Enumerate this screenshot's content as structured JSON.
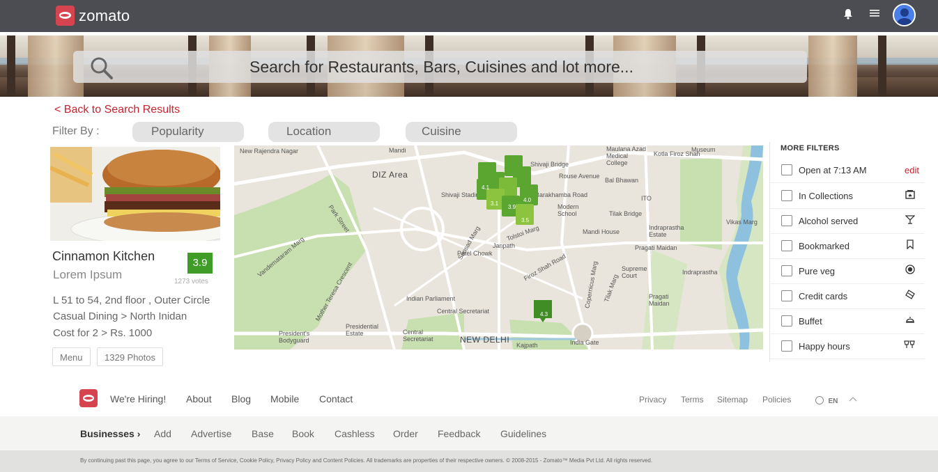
{
  "brand": {
    "name": "zomato"
  },
  "search": {
    "placeholder": "Search for Restaurants, Bars, Cuisines and lot more..."
  },
  "nav": {
    "back": "< Back to Search Results"
  },
  "filter_bar": {
    "label": "Filter By :",
    "options": [
      "Popularity",
      "Location",
      "Cuisine"
    ]
  },
  "restaurant": {
    "name": "Cinnamon Kitchen",
    "subtitle": "Lorem Ipsum",
    "rating": "3.9",
    "votes": "1273 votes",
    "address": "L 51 to 54, 2nd floor , Outer Circle",
    "type": "Casual Dining > North Inidan",
    "cost": "Cost for 2 > Rs. 1000",
    "buttons": [
      "Menu",
      "1329 Photos"
    ]
  },
  "map": {
    "labels": [
      "New Rajendra Nagar",
      "DIZ Area",
      "Mandi",
      "Shivaji Stadium",
      "Shivaji Bridge",
      "Rouse Avenue",
      "Bal Bhawan",
      "Maulana Azad Medical College",
      "Kotla Firoz Shah",
      "Museum",
      "ITO",
      "Vandemataram Marg",
      "Park Street",
      "Sansad Marg",
      "Tolstoi Marg",
      "Janpath",
      "Patel Chowk",
      "Firoz Shah Road",
      "Modern School",
      "Tilak Bridge",
      "Mandi House",
      "Indraprastha Estate",
      "Vikas Marg",
      "Pragati Maidan",
      "Supreme Court",
      "Indraprastha",
      "Pragati Maidan",
      "Indian Parliament",
      "Central Secretariat",
      "Presidential Estate",
      "Central Secretariat",
      "President's Bodyguard",
      "NEW DELHI",
      "Kajpath",
      "India Gate",
      "Mother Teresa Crescent",
      "Copernicus Marg",
      "Tilak Marg",
      "Barakhamba Road"
    ],
    "markers": [
      "4.1",
      "3.1",
      "3.9",
      "4.0",
      "3.5",
      "4.3"
    ]
  },
  "more_filters": {
    "title": "MORE FILTERS",
    "items": [
      {
        "label": "Open at 7:13 AM",
        "extra": "edit",
        "icon": "edit-link"
      },
      {
        "label": "In Collections",
        "icon": "collection-icon"
      },
      {
        "label": "Alcohol served",
        "icon": "cocktail-icon"
      },
      {
        "label": "Bookmarked",
        "icon": "bookmark-icon"
      },
      {
        "label": "Pure veg",
        "icon": "veg-icon"
      },
      {
        "label": "Credit cards",
        "icon": "card-icon"
      },
      {
        "label": "Buffet",
        "icon": "buffet-icon"
      },
      {
        "label": "Happy hours",
        "icon": "glasses-icon"
      }
    ]
  },
  "footer": {
    "links": [
      "We're Hiring!",
      "About",
      "Blog",
      "Mobile",
      "Contact"
    ],
    "right_links": [
      "Privacy",
      "Terms",
      "Sitemap",
      "Policies"
    ],
    "language": "EN",
    "businesses_label": "Businesses",
    "business_links": [
      "Add",
      "Advertise",
      "Base",
      "Book",
      "Cashless",
      "Order",
      "Feedback",
      "Guidelines"
    ],
    "legal": "By continuing past this page, you agree to our Terms of Service, Cookie Policy, Privacy Policy and Content Policies. All trademarks are properties of their respective owners. © 2008-2015 - Zomato™ Media Pvt Ltd. All rights reserved."
  },
  "colors": {
    "brand_red": "#cb202d",
    "rating_green": "#3f9d27",
    "topbar": "#4b4d53"
  }
}
